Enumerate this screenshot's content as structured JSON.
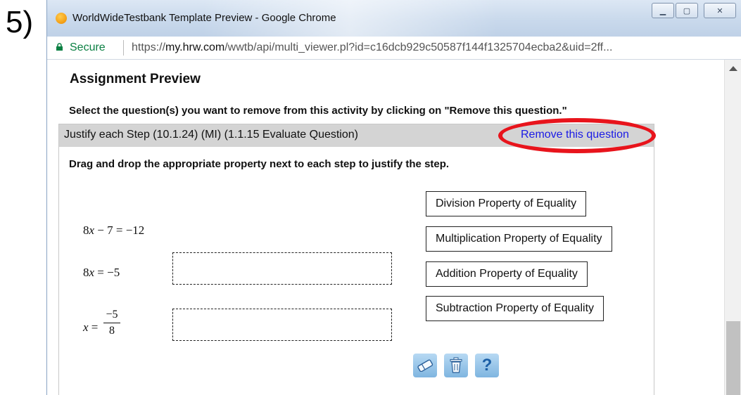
{
  "step_number": "5)",
  "window": {
    "title": "WorldWideTestbank Template Preview - Google Chrome",
    "controls": [
      "minimize",
      "maximize",
      "close"
    ]
  },
  "address_bar": {
    "secure_label": "Secure",
    "url_scheme": "https://",
    "url_host": "my.hrw.com",
    "url_path": "/wwtb/api/multi_viewer.pl?id=c16dcb929c50587f144f1325704ecba2&uid=2ff..."
  },
  "page": {
    "title": "Assignment Preview",
    "instructions": "Select the question(s) you want to remove from this activity by clicking on \"Remove this question.\""
  },
  "question": {
    "header_title": "Justify each Step (10.1.24) (MI) (1.1.15 Evaluate Question)",
    "remove_link": "Remove this question",
    "prompt": "Drag and drop the appropriate property next to each step to justify the step.",
    "steps": {
      "step1": {
        "coef": "8",
        "var": "x",
        "rest": " − 7 = −12"
      },
      "step2": {
        "coef": "8",
        "var": "x",
        "rest": " = −5"
      },
      "step3": {
        "var": "x",
        "eq": " = ",
        "numerator": "−5",
        "denominator": "8"
      }
    },
    "properties": [
      "Division Property of Equality",
      "Multiplication Property of Equality",
      "Addition Property of Equality",
      "Subtraction Property of Equality"
    ],
    "toolbar": {
      "eraser_icon": "eraser-icon",
      "trash_icon": "trash-icon",
      "help_label": "?"
    }
  },
  "colors": {
    "accent_link": "#1a1ae6",
    "highlight_oval": "#e8141c",
    "secure_green": "#0b8043"
  }
}
